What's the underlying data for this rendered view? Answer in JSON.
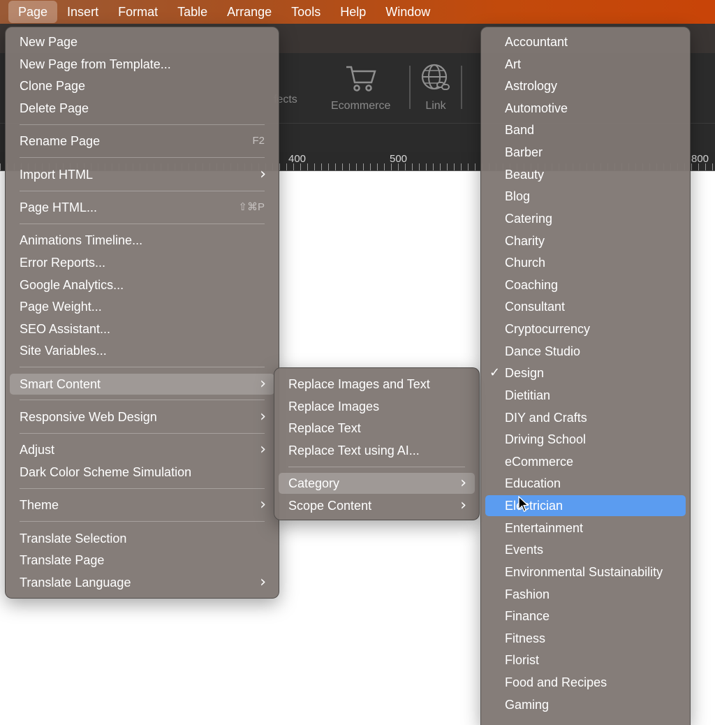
{
  "menubar": {
    "items": [
      "Page",
      "Insert",
      "Format",
      "Table",
      "Arrange",
      "Tools",
      "Help",
      "Window"
    ],
    "active": "Page"
  },
  "toolbar": {
    "tools": [
      {
        "label": "fects",
        "icon": "effects-icon"
      },
      {
        "label": "Ecommerce",
        "icon": "shopping-cart-icon"
      },
      {
        "label": "Link",
        "icon": "globe-link-icon"
      }
    ]
  },
  "ruler": {
    "labels": [
      "400",
      "500",
      "800"
    ]
  },
  "page_menu": {
    "items": [
      {
        "label": "New Page"
      },
      {
        "label": "New Page from Template..."
      },
      {
        "label": "Clone Page"
      },
      {
        "label": "Delete Page"
      },
      {
        "label": "Rename Page",
        "shortcut": "F2"
      },
      {
        "label": "Import HTML",
        "submenu": true
      },
      {
        "label": "Page HTML...",
        "shortcut": "⇧⌘P"
      },
      {
        "label": "Animations Timeline..."
      },
      {
        "label": "Error Reports..."
      },
      {
        "label": "Google Analytics..."
      },
      {
        "label": "Page Weight..."
      },
      {
        "label": "SEO Assistant..."
      },
      {
        "label": "Site Variables..."
      },
      {
        "label": "Smart Content",
        "submenu": true,
        "highlighted": true
      },
      {
        "label": "Responsive Web Design",
        "submenu": true
      },
      {
        "label": "Adjust",
        "submenu": true
      },
      {
        "label": "Dark Color Scheme Simulation"
      },
      {
        "label": "Theme",
        "submenu": true
      },
      {
        "label": "Translate Selection"
      },
      {
        "label": "Translate Page"
      },
      {
        "label": "Translate Language",
        "submenu": true
      }
    ]
  },
  "smart_content_menu": {
    "items": [
      {
        "label": "Replace Images and Text"
      },
      {
        "label": "Replace Images"
      },
      {
        "label": "Replace Text"
      },
      {
        "label": "Replace Text using AI..."
      },
      {
        "label": "Category",
        "submenu": true,
        "highlighted": true
      },
      {
        "label": "Scope Content",
        "submenu": true
      }
    ]
  },
  "category_menu": {
    "checked": "Design",
    "selected": "Electrician",
    "items": [
      "Accountant",
      "Art",
      "Astrology",
      "Automotive",
      "Band",
      "Barber",
      "Beauty",
      "Blog",
      "Catering",
      "Charity",
      "Church",
      "Coaching",
      "Consultant",
      "Cryptocurrency",
      "Dance Studio",
      "Design",
      "Dietitian",
      "DIY and Crafts",
      "Driving School",
      "eCommerce",
      "Education",
      "Electrician",
      "Entertainment",
      "Events",
      "Environmental Sustainability",
      "Fashion",
      "Finance",
      "Fitness",
      "Florist",
      "Food and Recipes",
      "Gaming"
    ]
  },
  "colors": {
    "menubar_start": "#9a5a36",
    "menubar_end": "#c84408",
    "menu_bg": "#807874",
    "selection": "#5b9cf0"
  }
}
